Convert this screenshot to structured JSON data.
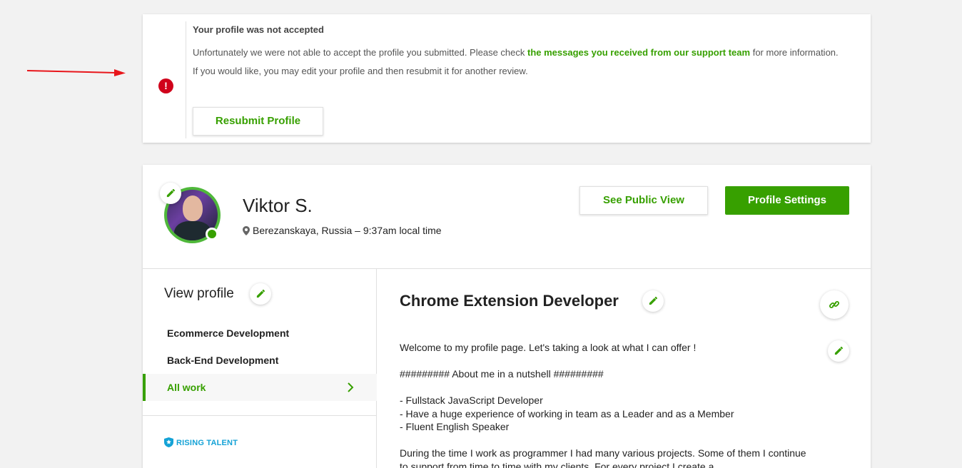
{
  "alert": {
    "title": "Your profile was not accepted",
    "text_before": "Unfortunately we were not able to accept the profile you submitted. Please check ",
    "link": "the messages you received from our support team",
    "text_after": " for more information.",
    "text2": "If you would like, you may edit your profile and then resubmit it for another review.",
    "icon": "!",
    "button": "Resubmit Profile"
  },
  "profile": {
    "name": "Viktor S.",
    "location": "Berezanskaya, Russia – 9:37am local time",
    "public_view": "See Public View",
    "settings": "Profile Settings"
  },
  "sidebar": {
    "heading": "View profile",
    "items": [
      {
        "label": "Ecommerce Development"
      },
      {
        "label": "Back-End Development"
      },
      {
        "label": "All work"
      }
    ],
    "badge": "RISING TALENT"
  },
  "main": {
    "title": "Chrome Extension Developer",
    "description": "Welcome to my profile page. Let's taking a look at what I can offer !\n\n######### About me in a nutshell #########\n\n- Fullstack JavaScript Developer\n- Have a huge experience of working in team as a Leader and as a Member\n- Fluent English Speaker\n\nDuring the time I work as programmer I had many various projects. Some of them I continue to support from time to time with my clients. For every project I create a"
  },
  "colors": {
    "accent": "#37a000",
    "error": "#d0021b",
    "badge": "#14a2d6",
    "arrow": "#e8161b"
  }
}
